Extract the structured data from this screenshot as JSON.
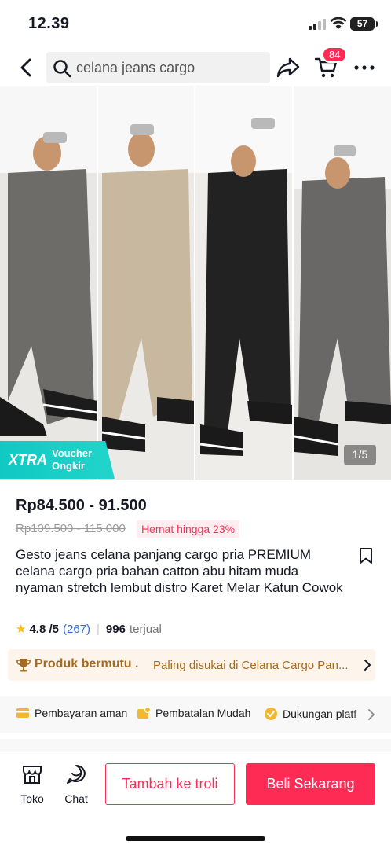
{
  "status": {
    "time": "12.39",
    "battery": "57"
  },
  "search": {
    "query": "celana jeans cargo"
  },
  "cart": {
    "badge": "84"
  },
  "hero": {
    "badge_main": "XTRA",
    "badge_sub_1": "Voucher",
    "badge_sub_2": "Ongkir",
    "pager": "1/5"
  },
  "product": {
    "price": "Rp84.500 - 91.500",
    "original_price": "Rp109.500 - 115.000",
    "discount": "Hemat hingga 23%",
    "title": "Gesto jeans celana panjang cargo pria PREMIUM celana cargo pria bahan catton abu hitam muda nyaman  stretch  lembut  distro Karet Melar Katun Cowok",
    "rating": "4.8 /5",
    "review_count": "(267)",
    "sold": "996",
    "sold_label": "terjual"
  },
  "quality": {
    "title": "Produk bermutu .",
    "desc": "Paling disukai di Celana Cargo Pan..."
  },
  "benefits": {
    "payment": "Pembayaran aman",
    "cancel": "Pembatalan Mudah",
    "support": "Dukungan platf"
  },
  "bottom": {
    "toko": "Toko",
    "chat": "Chat",
    "add_to_cart": "Tambah ke troli",
    "buy_now": "Beli Sekarang"
  },
  "colors": {
    "accent": "#fe2c55",
    "xtra": "#10c9c2",
    "quality": "#a66a1f",
    "star": "#fcbd06"
  }
}
